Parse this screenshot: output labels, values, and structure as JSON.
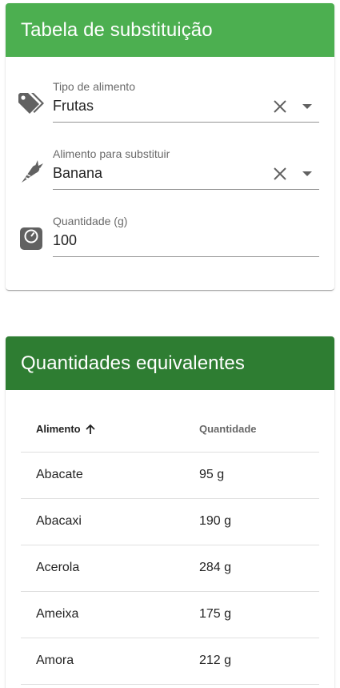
{
  "substitution_card": {
    "title": "Tabela de substituição",
    "food_type": {
      "label": "Tipo de alimento",
      "value": "Frutas",
      "icon": "tags-icon"
    },
    "food_to_replace": {
      "label": "Alimento para substituir",
      "value": "Banana",
      "icon": "carrot-icon"
    },
    "quantity": {
      "label": "Quantidade (g)",
      "value": "100",
      "icon": "scale-icon"
    }
  },
  "equivalents_card": {
    "title": "Quantidades equivalentes",
    "columns": {
      "food": "Alimento",
      "quantity": "Quantidade"
    },
    "sort": {
      "column": "food",
      "direction": "ascending",
      "icon": "arrow-up-icon"
    },
    "rows": [
      {
        "food": "Abacate",
        "quantity": "95 g"
      },
      {
        "food": "Abacaxi",
        "quantity": "190 g"
      },
      {
        "food": "Acerola",
        "quantity": "284 g"
      },
      {
        "food": "Ameixa",
        "quantity": "175 g"
      },
      {
        "food": "Amora",
        "quantity": "212 g"
      }
    ]
  },
  "colors": {
    "header_primary": "#4caf50",
    "header_dark": "#2e7d32"
  }
}
